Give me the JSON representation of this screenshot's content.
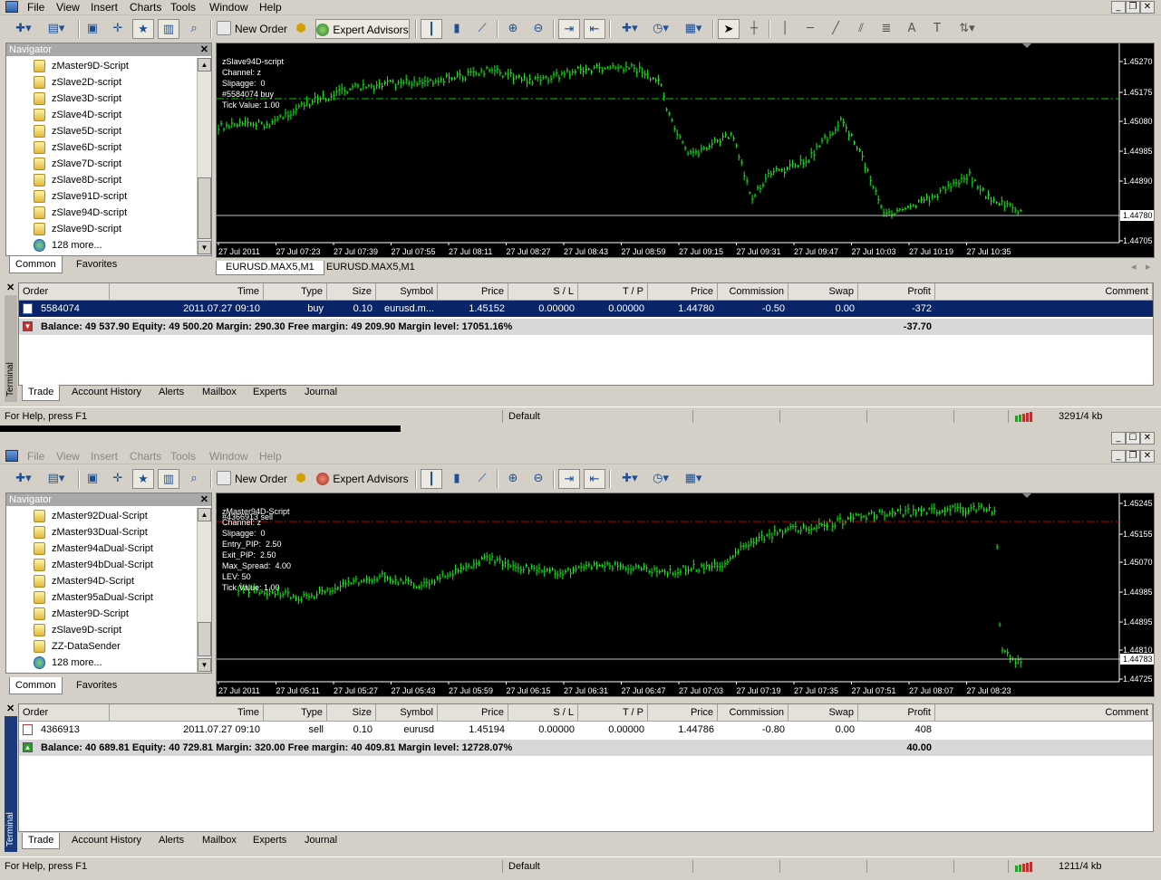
{
  "app": {
    "menu": [
      "File",
      "View",
      "Insert",
      "Charts",
      "Tools",
      "Window",
      "Help"
    ],
    "toolbar": {
      "new_order": "New Order",
      "expert_advisors": "Expert Advisors"
    }
  },
  "colors": {
    "chart_bg": "#000000",
    "candle": "#00ff00",
    "grid_line": "#bfbfbf",
    "buy_line": "#00cc00",
    "sell_line": "#cc0000",
    "selected_row": "#0a246a"
  },
  "windows": [
    {
      "navigator": {
        "title": "Navigator",
        "items": [
          "zMaster9D-Script",
          "zSlave2D-script",
          "zSlave3D-script",
          "zSlave4D-script",
          "zSlave5D-script",
          "zSlave6D-script",
          "zSlave7D-script",
          "zSlave8D-script",
          "zSlave91D-script",
          "zSlave94D-script",
          "zSlave9D-script",
          "128 more..."
        ],
        "tabs": [
          "Common",
          "Favorites"
        ]
      },
      "chart": {
        "info_lines": [
          "zSlave94D-script",
          "Channel: z",
          "Slipagge:  0",
          "#5584074 buy",
          "Tick Value: 1.00"
        ],
        "price_ticks": [
          "1.45270",
          "1.45175",
          "1.45080",
          "1.44985",
          "1.44890",
          "1.44780",
          "1.44705"
        ],
        "time_ticks": [
          "27 Jul 2011",
          "27 Jul 07:23",
          "27 Jul 07:39",
          "27 Jul 07:55",
          "27 Jul 08:11",
          "27 Jul 08:27",
          "27 Jul 08:43",
          "27 Jul 08:59",
          "27 Jul 09:15",
          "27 Jul 09:31",
          "27 Jul 09:47",
          "27 Jul 10:03",
          "27 Jul 10:19",
          "27 Jul 10:35"
        ],
        "tabs": [
          "EURUSD.MAX5,M1",
          "EURUSD.MAX5,M1"
        ]
      },
      "terminal": {
        "side_label": "Terminal",
        "columns": [
          "Order",
          "Time",
          "Type",
          "Size",
          "Symbol",
          "Price",
          "S / L",
          "T / P",
          "Price",
          "Commission",
          "Swap",
          "Profit",
          "Comment"
        ],
        "rows": [
          {
            "order": "5584074",
            "time": "2011.07.27 09:10",
            "type": "buy",
            "size": "0.10",
            "symbol": "eurusd.m...",
            "price": "1.45152",
            "sl": "0.00000",
            "tp": "0.00000",
            "cur_price": "1.44780",
            "commission": "-0.50",
            "swap": "0.00",
            "profit": "-372",
            "comment": ""
          }
        ],
        "balance_text": "Balance: 49 537.90  Equity: 49 500.20  Margin: 290.30  Free margin: 49 209.90  Margin level: 17051.16%",
        "balance_profit": "-37.70",
        "tabs": [
          "Trade",
          "Account History",
          "Alerts",
          "Mailbox",
          "Experts",
          "Journal"
        ]
      },
      "status": {
        "help": "For Help, press F1",
        "profile": "Default",
        "traffic": "3291/4 kb"
      }
    },
    {
      "navigator": {
        "title": "Navigator",
        "items": [
          "zMaster92Dual-Script",
          "zMaster93Dual-Script",
          "zMaster94aDual-Script",
          "zMaster94bDual-Script",
          "zMaster94D-Script",
          "zMaster95aDual-Script",
          "zMaster9D-Script",
          "zSlave9D-script",
          "ZZ-DataSender",
          "128 more..."
        ],
        "tabs": [
          "Common",
          "Favorites"
        ]
      },
      "chart": {
        "info_lines": [
          "zMaster94D-Script",
          "#4366913 sell",
          "Channel: z",
          "Slipagge:  0",
          "Entry_PIP:  2.50",
          "Exit_PIP:  2.50",
          "Max_Spread:  4.00",
          "LEV: 50",
          "Tick Value: 1.00"
        ],
        "price_ticks": [
          "1.45245",
          "1.45155",
          "1.45070",
          "1.44985",
          "1.44895",
          "1.44810",
          "1.44783",
          "1.44725"
        ],
        "time_ticks": [
          "27 Jul 2011",
          "27 Jul 05:11",
          "27 Jul 05:27",
          "27 Jul 05:43",
          "27 Jul 05:59",
          "27 Jul 06:15",
          "27 Jul 06:31",
          "27 Jul 06:47",
          "27 Jul 07:03",
          "27 Jul 07:19",
          "27 Jul 07:35",
          "27 Jul 07:51",
          "27 Jul 08:07",
          "27 Jul 08:23"
        ]
      },
      "terminal": {
        "side_label": "Terminal",
        "columns": [
          "Order",
          "Time",
          "Type",
          "Size",
          "Symbol",
          "Price",
          "S / L",
          "T / P",
          "Price",
          "Commission",
          "Swap",
          "Profit",
          "Comment"
        ],
        "rows": [
          {
            "order": "4366913",
            "time": "2011.07.27 09:10",
            "type": "sell",
            "size": "0.10",
            "symbol": "eurusd",
            "price": "1.45194",
            "sl": "0.00000",
            "tp": "0.00000",
            "cur_price": "1.44786",
            "commission": "-0.80",
            "swap": "0.00",
            "profit": "408",
            "comment": ""
          }
        ],
        "balance_text": "Balance: 40 689.81  Equity: 40 729.81  Margin: 320.00  Free margin: 40 409.81  Margin level: 12728.07%",
        "balance_profit": "40.00",
        "tabs": [
          "Trade",
          "Account History",
          "Alerts",
          "Mailbox",
          "Experts",
          "Journal"
        ]
      },
      "status": {
        "help": "For Help, press F1",
        "profile": "Default",
        "traffic": "1211/4 kb"
      }
    }
  ]
}
